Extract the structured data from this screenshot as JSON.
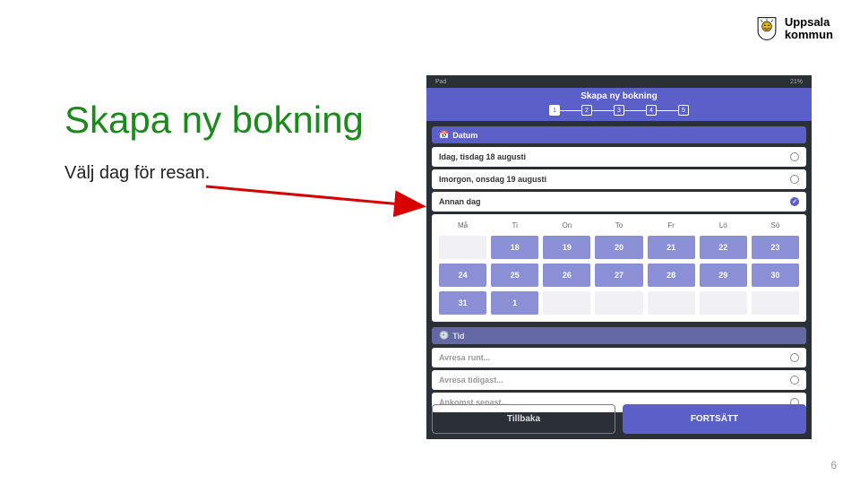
{
  "logo": {
    "line1": "Uppsala",
    "line2": "kommun"
  },
  "slide": {
    "title": "Skapa ny bokning",
    "subtitle": "Välj dag för resan.",
    "page_number": "6"
  },
  "device": {
    "status_left": "Pad",
    "status_right": "21%",
    "header_title": "Skapa ny bokning",
    "steps": [
      "1",
      "2",
      "3",
      "4",
      "5"
    ],
    "active_step": 0,
    "section_date": {
      "icon": "📅",
      "label": "Datum"
    },
    "options": {
      "today": "Idag, tisdag 18 augusti",
      "tomorrow": "Imorgon, onsdag 19 augusti",
      "other": "Annan dag"
    },
    "calendar": {
      "dow": [
        "Må",
        "Ti",
        "On",
        "To",
        "Fr",
        "Lö",
        "Sö"
      ],
      "rows": [
        [
          {
            "v": "",
            "t": "empty"
          },
          {
            "v": "18",
            "t": "on"
          },
          {
            "v": "19",
            "t": "on"
          },
          {
            "v": "20",
            "t": "on"
          },
          {
            "v": "21",
            "t": "on"
          },
          {
            "v": "22",
            "t": "on"
          },
          {
            "v": "23",
            "t": "on"
          }
        ],
        [
          {
            "v": "24",
            "t": "on"
          },
          {
            "v": "25",
            "t": "on"
          },
          {
            "v": "26",
            "t": "on"
          },
          {
            "v": "27",
            "t": "on"
          },
          {
            "v": "28",
            "t": "on"
          },
          {
            "v": "29",
            "t": "on"
          },
          {
            "v": "30",
            "t": "on"
          }
        ],
        [
          {
            "v": "31",
            "t": "on"
          },
          {
            "v": "1",
            "t": "on"
          },
          {
            "v": "",
            "t": "empty"
          },
          {
            "v": "",
            "t": "empty"
          },
          {
            "v": "",
            "t": "empty"
          },
          {
            "v": "",
            "t": "empty"
          },
          {
            "v": "",
            "t": "empty"
          }
        ]
      ]
    },
    "section_time": {
      "icon": "🕘",
      "label": "Tid"
    },
    "time_options": {
      "around": "Avresa runt...",
      "earliest": "Avresa tidigast...",
      "latest": "Ankomst senast..."
    },
    "buttons": {
      "back": "Tillbaka",
      "next": "FORTSÄTT"
    }
  }
}
